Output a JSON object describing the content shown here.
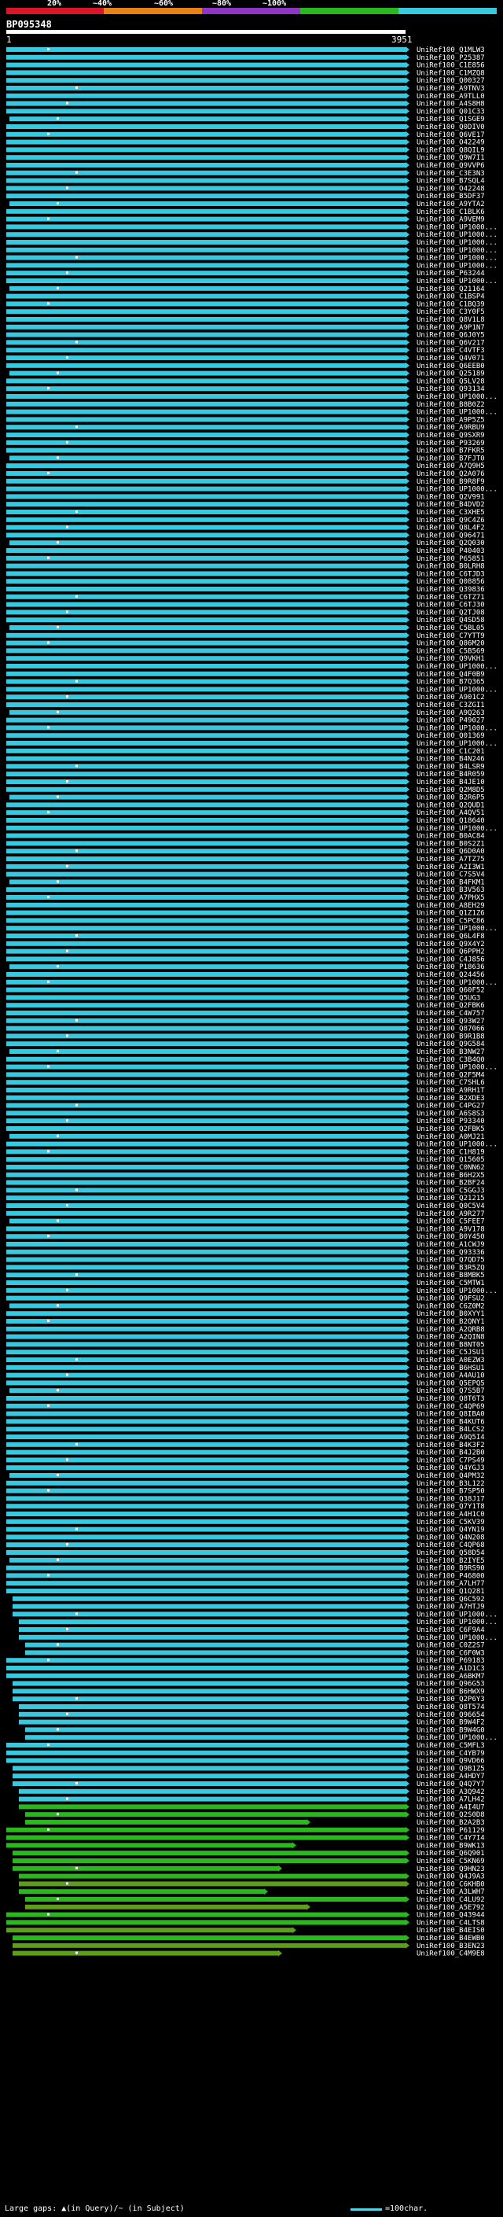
{
  "header": {
    "percent_marks": [
      "20%",
      "~40%",
      "~60%",
      "~80%",
      "~100%"
    ],
    "legend_colors": [
      "#d9152a",
      "#e8821a",
      "#8f35c7",
      "#2bb81f",
      "#36c9e0"
    ],
    "query_id": "BP095348",
    "query_start": "1",
    "query_end": "3951"
  },
  "footer": {
    "gaps_text": "Large gaps: ▲(in Query)/~ (in Subject)",
    "scale_text": "=100char."
  },
  "chart_data": {
    "type": "alignment-overview",
    "query_length": 3951,
    "colors": {
      "high": "#36c9e0",
      "green": "#2bb81f",
      "olive": "#5f9e1a",
      "connector": "#000000",
      "mark": "#ffffff"
    },
    "hits": [
      "UniRef100_Q1MLW3",
      "UniRef100_P25387",
      "UniRef100_C1E856",
      "UniRef100_C1MZQ8",
      "UniRef100_Q00327",
      "UniRef100_A9TNV3",
      "UniRef100_A9TLL0",
      "UniRef100_A4S8H8",
      "UniRef100_Q01C33",
      "UniRef100_Q1SGE9",
      "UniRef100_Q0DIV0",
      "UniRef100_Q6VE17",
      "UniRef100_O42249",
      "UniRef100_Q8QIL9",
      "UniRef100_Q9W7I1",
      "UniRef100_Q9VVP6",
      "UniRef100_C3E3N3",
      "UniRef100_B7SQL4",
      "UniRef100_O42248",
      "UniRef100_B5DF37",
      "UniRef100_A9YTA2",
      "UniRef100_C1BLK6",
      "UniRef100_A9VEM9",
      "UniRef100_UP1000...",
      "UniRef100_UP1000...",
      "UniRef100_UP1000...",
      "UniRef100_UP1000...",
      "UniRef100_UP1000...",
      "UniRef100_UP1000...",
      "UniRef100_P63244",
      "UniRef100_UP1000...",
      "UniRef100_Q21164",
      "UniRef100_C1BSP4",
      "UniRef100_C1BQ39",
      "UniRef100_C3Y0F5",
      "UniRef100_Q8V1L8",
      "UniRef100_A9P1N7",
      "UniRef100_Q6J0Y5",
      "UniRef100_Q6V217",
      "UniRef100_C4VTF3",
      "UniRef100_Q4V071",
      "UniRef100_Q6EEB0",
      "UniRef100_Q25189",
      "UniRef100_Q5LV28",
      "UniRef100_Q93134",
      "UniRef100_UP1000...",
      "UniRef100_B8B0Z2",
      "UniRef100_UP1000...",
      "UniRef100_A9P5Z5",
      "UniRef100_A9RBU9",
      "UniRef100_Q9SXR9",
      "UniRef100_P93269",
      "UniRef100_B7FKR5",
      "UniRef100_B7FJT0",
      "UniRef100_A7Q9H5",
      "UniRef100_Q2A076",
      "UniRef100_B9R8F9",
      "UniRef100_UP1000...",
      "UniRef100_Q2V991",
      "UniRef100_B4DVD2",
      "UniRef100_C3XHE5",
      "UniRef100_Q9C4Z6",
      "UniRef100_Q8L4F2",
      "UniRef100_Q96471",
      "UniRef100_Q2Q030",
      "UniRef100_P40403",
      "UniRef100_P65851",
      "UniRef100_B0LRH8",
      "UniRef100_C6TJD3",
      "UniRef100_Q08856",
      "UniRef100_Q39836",
      "UniRef100_C6TZ71",
      "UniRef100_C6TJ30",
      "UniRef100_Q2TJ08",
      "UniRef100_Q4SD58",
      "UniRef100_C5BL05",
      "UniRef100_C7YTT9",
      "UniRef100_Q86M20",
      "UniRef100_C5B569",
      "UniRef100_Q9VKH1",
      "UniRef100_UP1000...",
      "UniRef100_Q4F0B9",
      "UniRef100_B7Q365",
      "UniRef100_UP1000...",
      "UniRef100_A901C2",
      "UniRef100_C3ZGI1",
      "UniRef100_A9Q263",
      "UniRef100_P49027",
      "UniRef100_UP1000...",
      "UniRef100_Q01369",
      "UniRef100_UP1000...",
      "UniRef100_C1C201",
      "UniRef100_B4N246",
      "UniRef100_B4LSR9",
      "UniRef100_B4R059",
      "UniRef100_B4JE10",
      "UniRef100_Q2M8D5",
      "UniRef100_B2R6P5",
      "UniRef100_Q2QUD1",
      "UniRef100_A4QV51",
      "UniRef100_Q18640",
      "UniRef100_UP1000...",
      "UniRef100_B0AC84",
      "UniRef100_B0S2Z1",
      "UniRef100_Q6D0A0",
      "UniRef100_A7TZ75",
      "UniRef100_A2I3W1",
      "UniRef100_C7S5V4",
      "UniRef100_B4FKM1",
      "UniRef100_B3V563",
      "UniRef100_A7PHX5",
      "UniRef100_A8EH29",
      "UniRef100_Q1Z1Z6",
      "UniRef100_C5PC86",
      "UniRef100_UP1000...",
      "UniRef100_Q6L4F8",
      "UniRef100_Q9X4Y2",
      "UniRef100_Q6PPH2",
      "UniRef100_C4J856",
      "UniRef100_P18636",
      "UniRef100_Q24456",
      "UniRef100_UP1000...",
      "UniRef100_Q60F52",
      "UniRef100_Q5UG3",
      "UniRef100_Q2FBK6",
      "UniRef100_C4W757",
      "UniRef100_Q93W27",
      "UniRef100_Q87066",
      "UniRef100_B9R1B8",
      "UniRef100_Q9G584",
      "UniRef100_B3NW27",
      "UniRef100_C3B4Q0",
      "UniRef100_UP1000...",
      "UniRef100_Q2F5M4",
      "UniRef100_C7SHL6",
      "UniRef100_A9RH1T",
      "UniRef100_B2XDE3",
      "UniRef100_C4PG27",
      "UniRef100_A6S8S3",
      "UniRef100_P93340",
      "UniRef100_Q2FBK5",
      "UniRef100_A0MJ21",
      "UniRef100_UP1000...",
      "UniRef100_C1H819",
      "UniRef100_Q15605",
      "UniRef100_C0NN62",
      "UniRef100_B6H2X5",
      "UniRef100_B2BF24",
      "UniRef100_C5GGJ3",
      "UniRef100_Q21215",
      "UniRef100_Q0C5V4",
      "UniRef100_A9R277",
      "UniRef100_C5FEE7",
      "UniRef100_A9V178",
      "UniRef100_B0Y450",
      "UniRef100_A1CWJ9",
      "UniRef100_Q93336",
      "UniRef100_Q7QD75",
      "UniRef100_B3R5ZQ",
      "UniRef100_B8MBK5",
      "UniRef100_C5MTW1",
      "UniRef100_UP1000...",
      "UniRef100_Q9FSU2",
      "UniRef100_C6Z0M2",
      "UniRef100_B0XYY1",
      "UniRef100_B2QNY1",
      "UniRef100_A2QRB8",
      "UniRef100_A2QIN8",
      "UniRef100_B8NT05",
      "UniRef100_C5JSU1",
      "UniRef100_A0EZW3",
      "UniRef100_B6HSU1",
      "UniRef100_A4AU10",
      "UniRef100_Q5EPQ5",
      "UniRef100_Q7S5B7",
      "UniRef100_Q8T6T3",
      "UniRef100_C4QP69",
      "UniRef100_Q8IBA0",
      "UniRef100_B4KUT6",
      "UniRef100_B4LCS2",
      "UniRef100_A9Q5I4",
      "UniRef100_B4K3F2",
      "UniRef100_B4J2B0",
      "UniRef100_C7PS49",
      "UniRef100_Q4YGJ3",
      "UniRef100_Q4PM32",
      "UniRef100_B3L122",
      "UniRef100_B7SP50",
      "UniRef100_Q38J17",
      "UniRef100_Q7Y1T8",
      "UniRef100_A4H1C0",
      "UniRef100_C5KV39",
      "UniRef100_Q4YN19",
      "UniRef100_Q4N208",
      "UniRef100_C4QP68",
      "UniRef100_Q58D54",
      "UniRef100_B2IYE5",
      "UniRef100_B9RS90",
      "UniRef100_P46800",
      "UniRef100_A7LH77",
      "UniRef100_Q1Q281",
      "UniRef100_Q6C592",
      "UniRef100_A7HTJ9",
      "UniRef100_UP1000...",
      "UniRef100_UP1000...",
      "UniRef100_C6F9A4",
      "UniRef100_UP1000...",
      "UniRef100_C0Z2S7",
      "UniRef100_C6F0W3",
      "UniRef100_P69183",
      "UniRef100_A1D1C3",
      "UniRef100_A6BKM7",
      "UniRef100_Q96G53",
      "UniRef100_B6HWX9",
      "UniRef100_Q2P6Y3",
      "UniRef100_Q8T574",
      "UniRef100_Q96654",
      "UniRef100_B9W4F2",
      "UniRef100_B9W4G0",
      "UniRef100_UP1000...",
      "UniRef100_C5MFL3",
      "UniRef100_C4YB79",
      "UniRef100_Q9VD66",
      "UniRef100_Q9B1Z5",
      "UniRef100_A4HDY7",
      "UniRef100_Q4Q7Y7",
      "UniRef100_A3Q942",
      "UniRef100_A7LH42",
      "UniRef100_A4I4U7",
      "UniRef100_Q2S0D8",
      "UniRef100_B2A2B3",
      "UniRef100_P61129",
      "UniRef100_C4Y7I4",
      "UniRef100_B9WK13",
      "UniRef100_Q6Q901",
      "UniRef100_C5KN69",
      "UniRef100_Q9HN23",
      "UniRef100_Q4J9A3",
      "UniRef100_C6KHB0",
      "UniRef100_A3LWH7",
      "UniRef100_C4LU92",
      "UniRef100_A5E792",
      "UniRef100_Q43944",
      "UniRef100_C4LTS8",
      "UniRef100_B4EIS0",
      "UniRef100_B4EWB0",
      "UniRef100_B3EN23",
      "UniRef100_C4M9E8"
    ]
  }
}
